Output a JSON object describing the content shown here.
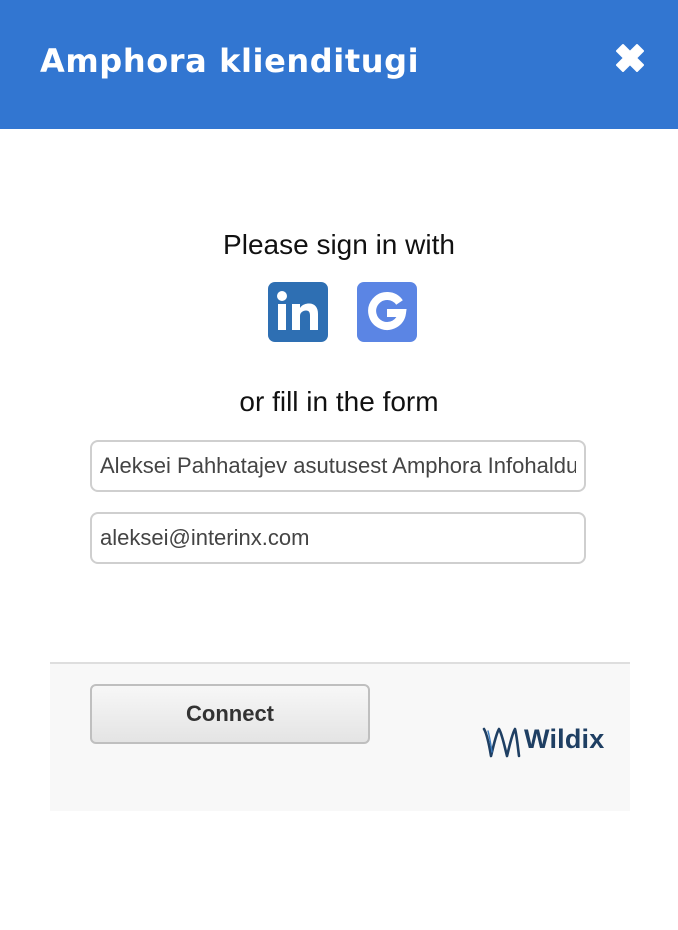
{
  "header": {
    "title": "Amphora klienditugi",
    "close_icon": "close-icon",
    "background_color": "#3276d1"
  },
  "signin": {
    "prompt": "Please sign in with",
    "providers": [
      {
        "name": "LinkedIn",
        "icon": "linkedin-icon",
        "color": "#2e6fb3"
      },
      {
        "name": "Google",
        "icon": "google-icon",
        "color": "#5b85e4"
      }
    ],
    "alt_prompt": "or fill in the form"
  },
  "form": {
    "name_value": "Aleksei Pahhatajev asutusest Amphora Infohaldus",
    "email_value": "aleksei@interinx.com"
  },
  "footer": {
    "connect_label": "Connect",
    "brand_name": "Wildix",
    "brand_color": "#1f3f63"
  }
}
